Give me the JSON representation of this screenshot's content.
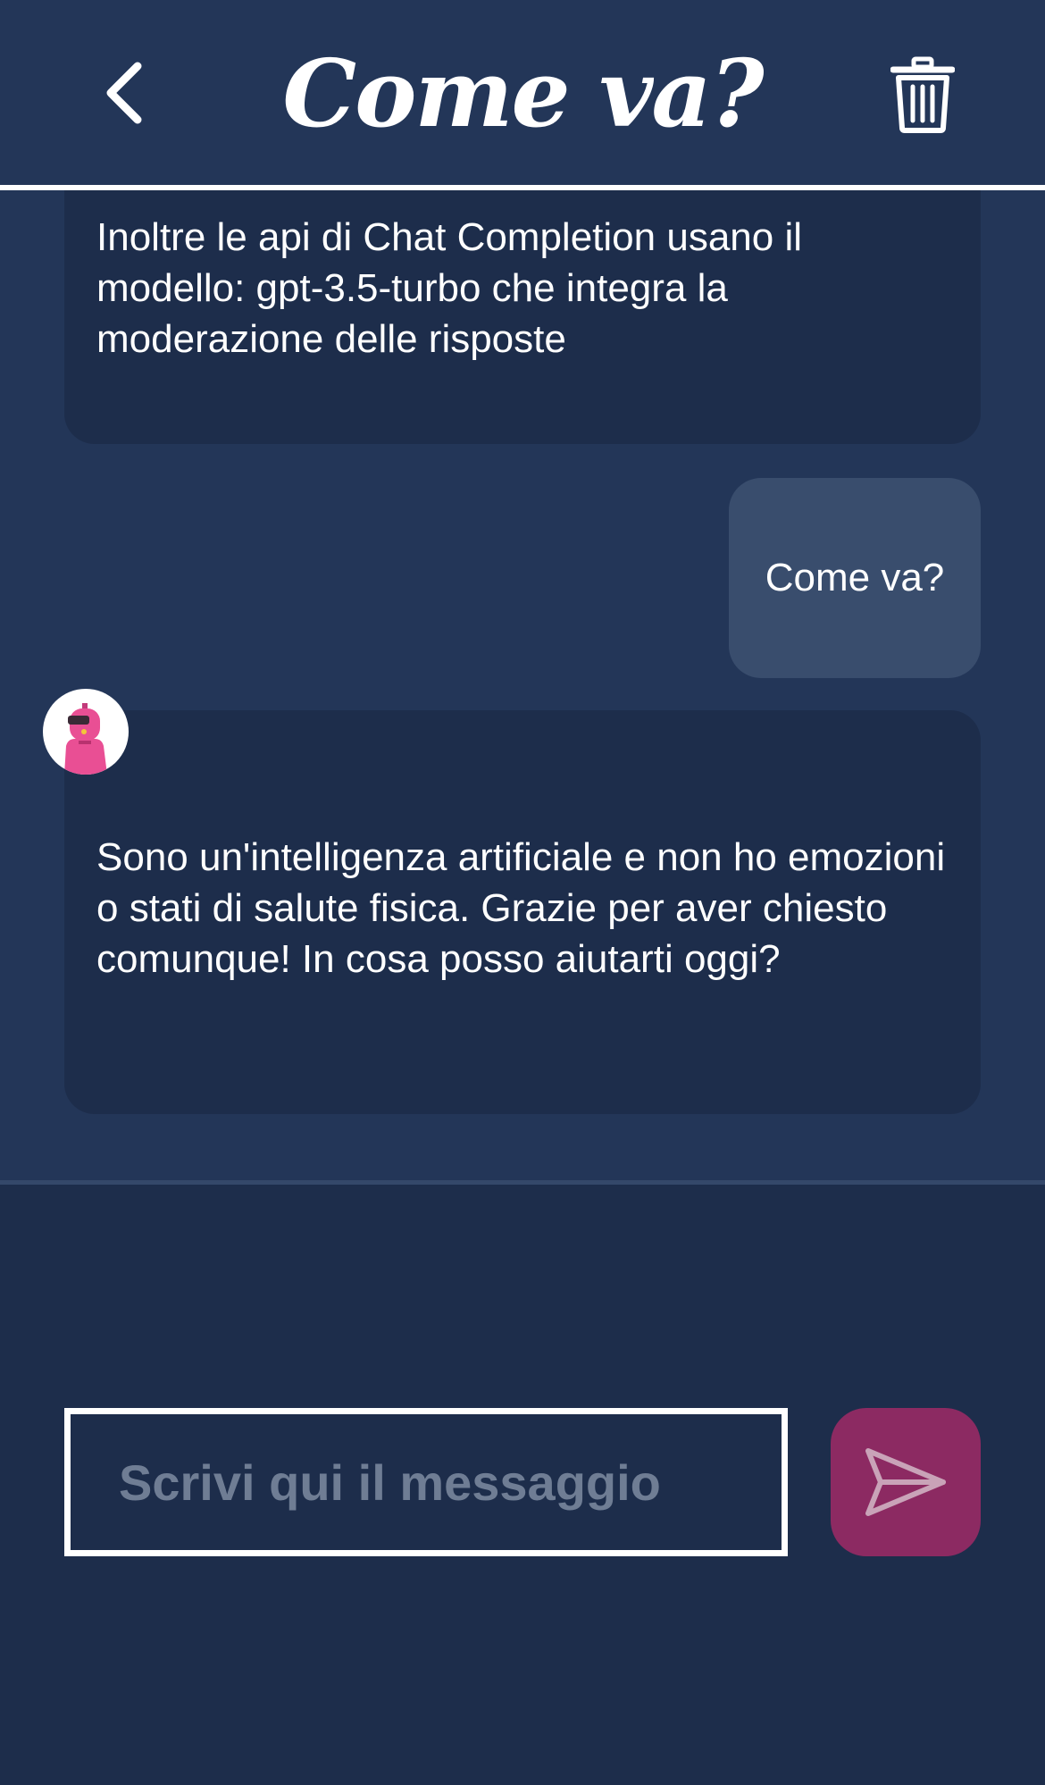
{
  "header": {
    "title": "Come va?",
    "back_icon": "chevron-left-icon",
    "delete_icon": "trash-icon"
  },
  "messages": [
    {
      "role": "bot",
      "text": "Inoltre le api di Chat Completion usano il modello: gpt-3.5-turbo che integra la moderazione delle risposte"
    },
    {
      "role": "user",
      "text": "Come va?"
    },
    {
      "role": "bot",
      "text": "Sono un'intelligenza artificiale e non ho emozioni o stati di salute fisica. Grazie per aver chiesto comunque! In cosa posso aiutarti oggi?"
    }
  ],
  "composer": {
    "placeholder": "Scrivi qui il messaggio",
    "send_icon": "send-icon"
  },
  "colors": {
    "background": "#1d2d4b",
    "chat_background": "#233658",
    "user_bubble": "#394d6d",
    "send_button": "#8c2a62"
  }
}
